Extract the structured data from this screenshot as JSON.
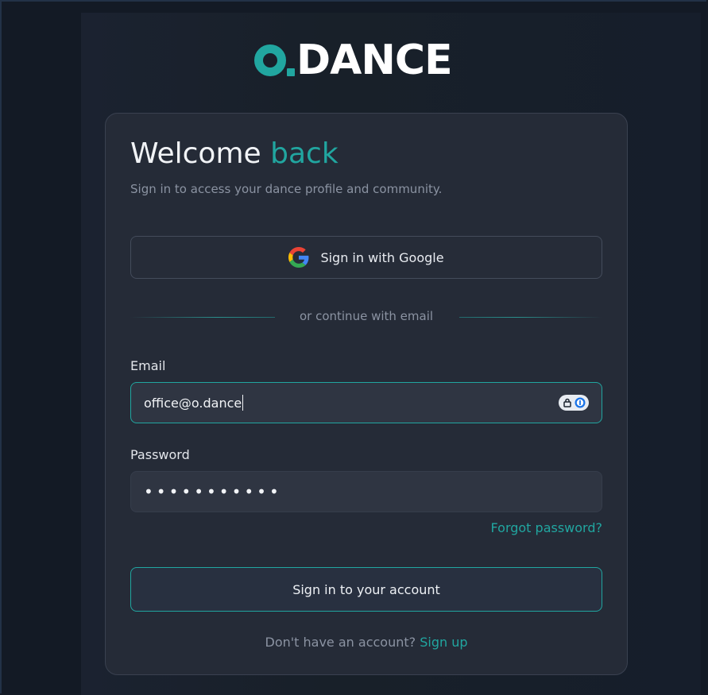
{
  "brand": {
    "logo_text": "o.DANCE",
    "accent_color": "#21a6a0",
    "text_color": "#ffffff"
  },
  "login_card": {
    "title_prefix": "Welcome",
    "title_accent": "back",
    "subtitle": "Sign in to access your dance profile and community.",
    "google_button_label": "Sign in with Google",
    "google_icon": "google-g-logo-icon",
    "divider_text": "or continue with email",
    "email": {
      "label": "Email",
      "value": "office@o.dance",
      "password_manager_icon": "lock-1password-icon"
    },
    "password": {
      "label": "Password",
      "masked_value": "•••••••••••"
    },
    "forgot_password_label": "Forgot password?",
    "submit_label": "Sign in to your account",
    "signup_prompt": "Don't have an account?",
    "signup_link": "Sign up"
  }
}
